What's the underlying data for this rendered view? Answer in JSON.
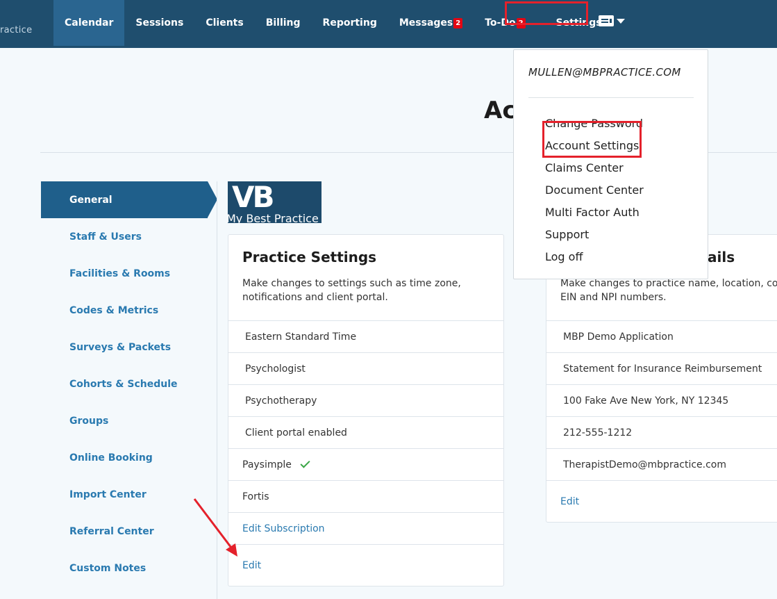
{
  "brand": {
    "text": "ractice"
  },
  "nav": {
    "items": [
      {
        "label": "Calendar",
        "active": true
      },
      {
        "label": "Sessions"
      },
      {
        "label": "Clients"
      },
      {
        "label": "Billing"
      },
      {
        "label": "Reporting"
      },
      {
        "label": "Messages",
        "badge": "2"
      },
      {
        "label": "To-Do",
        "badge": "2"
      },
      {
        "label": "Settings"
      }
    ]
  },
  "page": {
    "title": "Ac"
  },
  "sidebar": {
    "items": [
      {
        "label": "General",
        "active": true
      },
      {
        "label": "Staff & Users"
      },
      {
        "label": "Facilities & Rooms"
      },
      {
        "label": "Codes & Metrics"
      },
      {
        "label": "Surveys & Packets"
      },
      {
        "label": "Cohorts & Schedule"
      },
      {
        "label": "Groups"
      },
      {
        "label": "Online Booking"
      },
      {
        "label": "Import Center"
      },
      {
        "label": "Referral Center"
      },
      {
        "label": "Custom Notes"
      }
    ]
  },
  "logo": {
    "mark": "VB",
    "text": "My Best Practice"
  },
  "practice_settings": {
    "title": "Practice Settings",
    "description": "Make changes to settings such as time zone, notifications and client portal.",
    "rows": [
      "Eastern Standard Time",
      "Psychologist",
      "Psychotherapy",
      "Client portal enabled"
    ],
    "paysimple": "Paysimple",
    "fortis": "Fortis",
    "edit_subscription": "Edit Subscription",
    "edit": "Edit"
  },
  "practice_details": {
    "title_fragment": "ails",
    "description": "Make changes to practice name, location, co EIN and NPI numbers.",
    "rows": [
      "MBP Demo Application",
      "Statement for Insurance Reimbursement",
      "100 Fake Ave New York, NY 12345",
      "212-555-1212",
      "TherapistDemo@mbpractice.com"
    ],
    "edit": "Edit"
  },
  "dropdown": {
    "email": "MULLEN@MBPRACTICE.COM",
    "items": [
      "Change Password",
      "Account Settings",
      "Claims Center",
      "Document Center",
      "Multi Factor Auth",
      "Support",
      "Log off"
    ]
  },
  "colors": {
    "nav_bg": "#1f4e6e",
    "accent": "#2a7ab0",
    "highlight": "#e4212b",
    "check": "#3aa646"
  }
}
